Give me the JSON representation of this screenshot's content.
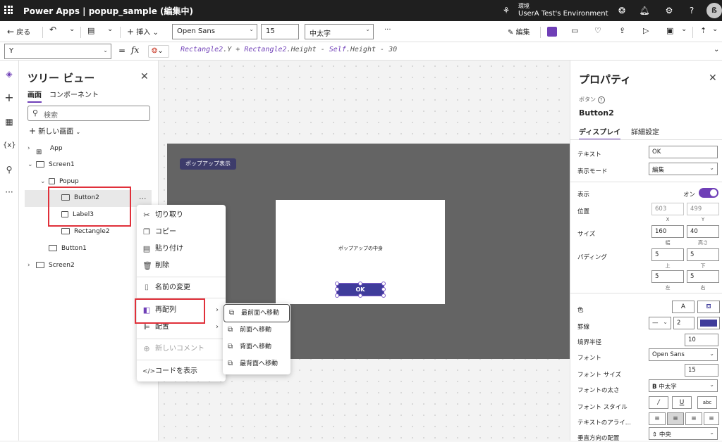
{
  "topbar": {
    "app_title": "Power Apps  |  popup_sample (編集中)",
    "env_label": "環境",
    "env_name": "UserA Test's Environment",
    "avatar_initial": "ß"
  },
  "commandbar": {
    "back": "戻る",
    "insert": "挿入",
    "font": "Open Sans",
    "font_size": "15",
    "font_weight": "中太字",
    "more": "···",
    "edit": "編集"
  },
  "formulabar": {
    "property": "Y",
    "fx": "fx",
    "formula_parts": [
      "Rectangle2",
      ".Y + ",
      "Rectangle2",
      ".Height - ",
      "Self",
      ".Height - 30"
    ]
  },
  "tree": {
    "title": "ツリー ビュー",
    "tab_screen": "画面",
    "tab_component": "コンポーネント",
    "search_placeholder": "検索",
    "new_screen": "新しい画面",
    "nodes": [
      "App",
      "Screen1",
      "Popup",
      "Button2",
      "Label3",
      "Rectangle2",
      "Button1",
      "Screen2"
    ]
  },
  "canvas": {
    "show_popup_button": "ポップアップ表示",
    "popup_text": "ポップアップの中身",
    "ok_button": "OK"
  },
  "context_menu": {
    "items": [
      "切り取り",
      "コピー",
      "貼り付け",
      "削除",
      "名前の変更",
      "再配列",
      "配置",
      "新しいコメント",
      "コードを表示"
    ]
  },
  "submenu": {
    "items": [
      "最前面へ移動",
      "前面へ移動",
      "背面へ移動",
      "最背面へ移動"
    ]
  },
  "props": {
    "title": "プロパティ",
    "kind": "ボタン",
    "name": "Button2",
    "tab_display": "ディスプレイ",
    "tab_advanced": "詳細設定",
    "text_label": "テキスト",
    "text_value": "OK",
    "mode_label": "表示モード",
    "mode_value": "編集",
    "visible_label": "表示",
    "visible_value": "オン",
    "position_label": "位置",
    "pos_x": "603",
    "pos_y": "499",
    "x_label": "X",
    "y_label": "Y",
    "size_label": "サイズ",
    "width": "160",
    "height": "40",
    "width_label": "幅",
    "height_label": "高さ",
    "padding_label": "パディング",
    "pad_top": "5",
    "pad_bottom": "5",
    "pad_left": "5",
    "pad_right": "5",
    "top_label": "上",
    "bottom_label": "下",
    "left_label": "左",
    "right_label": "右",
    "color_label": "色",
    "border_label": "罫線",
    "border_width": "2",
    "radius_label": "境界半径",
    "radius_value": "10",
    "font_label": "フォント",
    "font_value": "Open Sans",
    "fontsize_label": "フォント サイズ",
    "fontsize_value": "15",
    "weight_label": "フォントの太さ",
    "weight_value": "中太字",
    "style_label": "フォント スタイル",
    "align_label": "テキストのアライ...",
    "valign_label": "垂直方向の配置",
    "valign_value": "中央",
    "border_color": "#3f3c9b"
  }
}
